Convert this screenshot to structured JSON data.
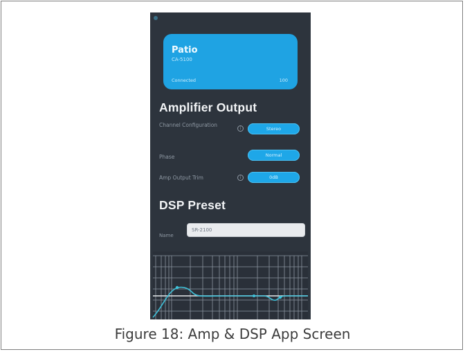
{
  "device_card": {
    "name": "Patio",
    "model": "CA-5100",
    "status": "Connected",
    "value": "100"
  },
  "amplifier_output": {
    "title": "Amplifier Output",
    "rows": [
      {
        "label": "Channel Configuration",
        "value": "Stereo"
      },
      {
        "label": "Phase",
        "value": "Normal"
      },
      {
        "label": "Amp Output Trim",
        "value": "0dB"
      }
    ]
  },
  "dsp_preset": {
    "title": "DSP Preset",
    "name_label": "Name",
    "name_value": "SR-2100"
  },
  "caption": "Figure 18: Amp & DSP App Screen",
  "colors": {
    "screen_background": "#2d343d",
    "accent": "#1fa3e3",
    "curve": "#3fc1d9"
  }
}
